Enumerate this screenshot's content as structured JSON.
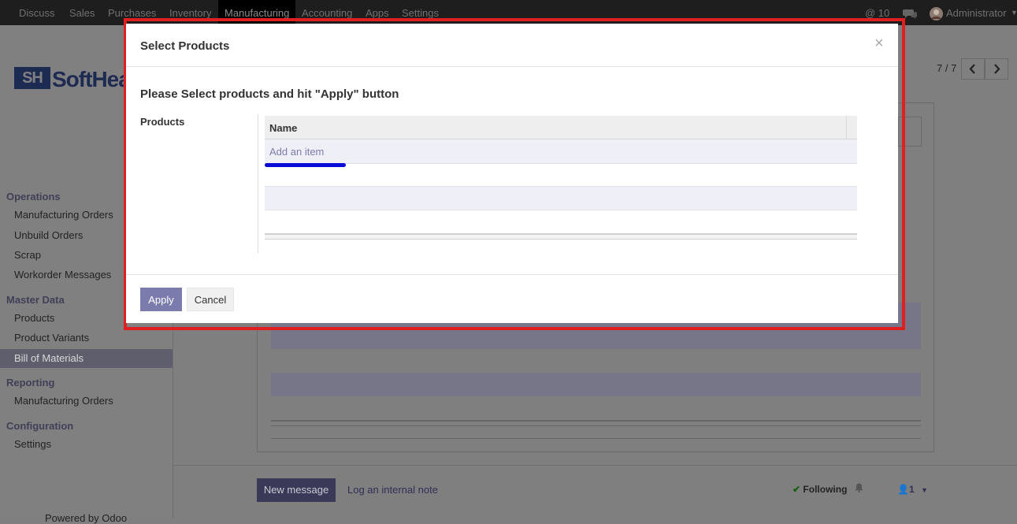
{
  "topbar": {
    "menu": [
      "Discuss",
      "Sales",
      "Purchases",
      "Inventory",
      "Manufacturing",
      "Accounting",
      "Apps",
      "Settings"
    ],
    "active_menu": "Manufacturing",
    "mentions_count": "@ 10",
    "user_name": "Administrator"
  },
  "sidebar": {
    "brand": "Soft",
    "brand_tail": "Hea",
    "sections": [
      {
        "title": "Operations",
        "items": [
          "Manufacturing Orders",
          "Unbuild Orders",
          "Scrap",
          "Workorder Messages"
        ]
      },
      {
        "title": "Master Data",
        "items": [
          "Products",
          "Product Variants",
          "Bill of Materials"
        ]
      },
      {
        "title": "Reporting",
        "items": [
          "Manufacturing Orders"
        ]
      },
      {
        "title": "Configuration",
        "items": [
          "Settings"
        ]
      }
    ],
    "active_item": "Bill of Materials",
    "powered_by": "Powered by Odoo"
  },
  "pager": {
    "text": "7 / 7"
  },
  "chatter": {
    "new_message": "New message",
    "log_note": "Log an internal note",
    "following": "Following",
    "followers": "1"
  },
  "modal": {
    "title": "Select Products",
    "close": "×",
    "instruction": "Please Select products and hit \"Apply\" button",
    "field_label": "Products",
    "column_name": "Name",
    "add_item": "Add an item",
    "apply": "Apply",
    "cancel": "Cancel"
  },
  "colors": {
    "accent": "#7c7bad",
    "highlight_outline": "#e02020",
    "scroll_marker": "#0a0ad6"
  }
}
